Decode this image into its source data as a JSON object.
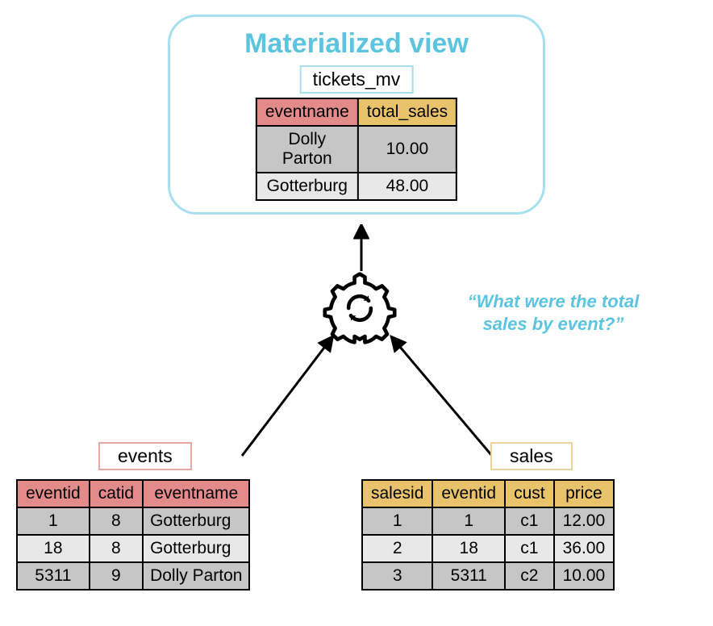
{
  "mv": {
    "title": "Materialized view",
    "name": "tickets_mv",
    "columns": {
      "eventname": "eventname",
      "total_sales": "total_sales"
    },
    "rows": [
      {
        "eventname": "Dolly Parton",
        "total_sales": "10.00"
      },
      {
        "eventname": "Gotterburg",
        "total_sales": "48.00"
      }
    ]
  },
  "quote": "“What were the total sales by event?”",
  "events": {
    "name": "events",
    "columns": {
      "eventid": "eventid",
      "catid": "catid",
      "eventname": "eventname"
    },
    "rows": [
      {
        "eventid": "1",
        "catid": "8",
        "eventname": "Gotterburg"
      },
      {
        "eventid": "18",
        "catid": "8",
        "eventname": "Gotterburg"
      },
      {
        "eventid": "5311",
        "catid": "9",
        "eventname": "Dolly Parton"
      }
    ]
  },
  "sales": {
    "name": "sales",
    "columns": {
      "salesid": "salesid",
      "eventid": "eventid",
      "cust": "cust",
      "price": "price"
    },
    "rows": [
      {
        "salesid": "1",
        "eventid": "1",
        "cust": "c1",
        "price": "12.00"
      },
      {
        "salesid": "2",
        "eventid": "18",
        "cust": "c1",
        "price": "36.00"
      },
      {
        "salesid": "3",
        "eventid": "5311",
        "cust": "c2",
        "price": "10.00"
      }
    ]
  }
}
